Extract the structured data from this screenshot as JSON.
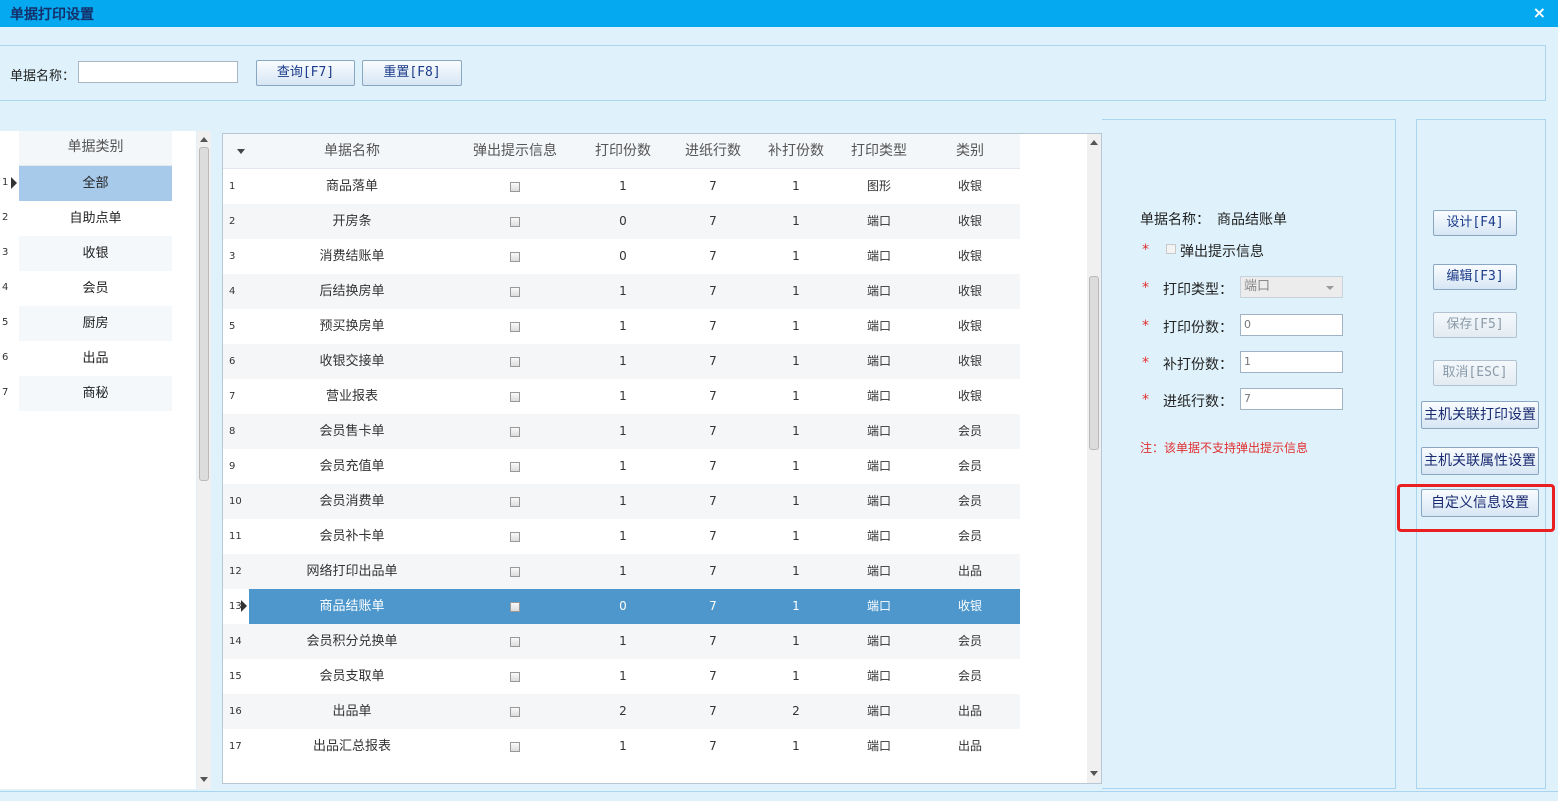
{
  "window": {
    "title": "单据打印设置",
    "close_glyph": "×"
  },
  "search": {
    "label": "单据名称：",
    "value": "",
    "query_button": "查询[F7]",
    "reset_button": "重置[F8]"
  },
  "categories": {
    "header": "单据类别",
    "items": [
      {
        "num": "1",
        "label": "全部",
        "selected": true
      },
      {
        "num": "2",
        "label": "自助点单"
      },
      {
        "num": "3",
        "label": "收银"
      },
      {
        "num": "4",
        "label": "会员"
      },
      {
        "num": "5",
        "label": "厨房"
      },
      {
        "num": "6",
        "label": "出品"
      },
      {
        "num": "7",
        "label": "商秘"
      }
    ]
  },
  "grid": {
    "columns": [
      "单据名称",
      "弹出提示信息",
      "打印份数",
      "进纸行数",
      "补打份数",
      "打印类型",
      "类别"
    ],
    "rows": [
      {
        "n": "1",
        "name": "商品落单",
        "copies": "1",
        "feed": "7",
        "reprint": "1",
        "type": "图形",
        "cat": "收银"
      },
      {
        "n": "2",
        "name": "开房条",
        "copies": "0",
        "feed": "7",
        "reprint": "1",
        "type": "端口",
        "cat": "收银"
      },
      {
        "n": "3",
        "name": "消费结账单",
        "copies": "0",
        "feed": "7",
        "reprint": "1",
        "type": "端口",
        "cat": "收银"
      },
      {
        "n": "4",
        "name": "后结换房单",
        "copies": "1",
        "feed": "7",
        "reprint": "1",
        "type": "端口",
        "cat": "收银"
      },
      {
        "n": "5",
        "name": "预买换房单",
        "copies": "1",
        "feed": "7",
        "reprint": "1",
        "type": "端口",
        "cat": "收银"
      },
      {
        "n": "6",
        "name": "收银交接单",
        "copies": "1",
        "feed": "7",
        "reprint": "1",
        "type": "端口",
        "cat": "收银"
      },
      {
        "n": "7",
        "name": "营业报表",
        "copies": "1",
        "feed": "7",
        "reprint": "1",
        "type": "端口",
        "cat": "收银"
      },
      {
        "n": "8",
        "name": "会员售卡单",
        "copies": "1",
        "feed": "7",
        "reprint": "1",
        "type": "端口",
        "cat": "会员"
      },
      {
        "n": "9",
        "name": "会员充值单",
        "copies": "1",
        "feed": "7",
        "reprint": "1",
        "type": "端口",
        "cat": "会员"
      },
      {
        "n": "10",
        "name": "会员消费单",
        "copies": "1",
        "feed": "7",
        "reprint": "1",
        "type": "端口",
        "cat": "会员"
      },
      {
        "n": "11",
        "name": "会员补卡单",
        "copies": "1",
        "feed": "7",
        "reprint": "1",
        "type": "端口",
        "cat": "会员"
      },
      {
        "n": "12",
        "name": "网络打印出品单",
        "copies": "1",
        "feed": "7",
        "reprint": "1",
        "type": "端口",
        "cat": "出品"
      },
      {
        "n": "13",
        "name": "商品结账单",
        "copies": "0",
        "feed": "7",
        "reprint": "1",
        "type": "端口",
        "cat": "收银",
        "selected": true
      },
      {
        "n": "14",
        "name": "会员积分兑换单",
        "copies": "1",
        "feed": "7",
        "reprint": "1",
        "type": "端口",
        "cat": "会员"
      },
      {
        "n": "15",
        "name": "会员支取单",
        "copies": "1",
        "feed": "7",
        "reprint": "1",
        "type": "端口",
        "cat": "会员"
      },
      {
        "n": "16",
        "name": "出品单",
        "copies": "2",
        "feed": "7",
        "reprint": "2",
        "type": "端口",
        "cat": "出品"
      },
      {
        "n": "17",
        "name": "出品汇总报表",
        "copies": "1",
        "feed": "7",
        "reprint": "1",
        "type": "端口",
        "cat": "出品"
      }
    ]
  },
  "detail": {
    "name_label": "单据名称：",
    "name_value": "商品结账单",
    "required_mark": "*",
    "popup_label": "弹出提示信息",
    "print_type_label": "打印类型：",
    "print_type_value": "端口",
    "copies_label": "打印份数：",
    "copies_value": "0",
    "reprint_label": "补打份数：",
    "reprint_value": "1",
    "feed_label": "进纸行数：",
    "feed_value": "7",
    "note": "注：该单据不支持弹出提示信息"
  },
  "actions": {
    "design": "设计[F4]",
    "edit": "编辑[F3]",
    "save": "保存[F5]",
    "cancel": "取消[ESC]",
    "host_print": "主机关联打印设置",
    "host_attr": "主机关联属性设置",
    "custom_info": "自定义信息设置"
  },
  "colors": {
    "titlebar": "#05a9ef",
    "selection": "#4d97cc",
    "category_selection": "#a7c9ea",
    "highlight_box": "#ea2020",
    "required": "#e03030"
  }
}
